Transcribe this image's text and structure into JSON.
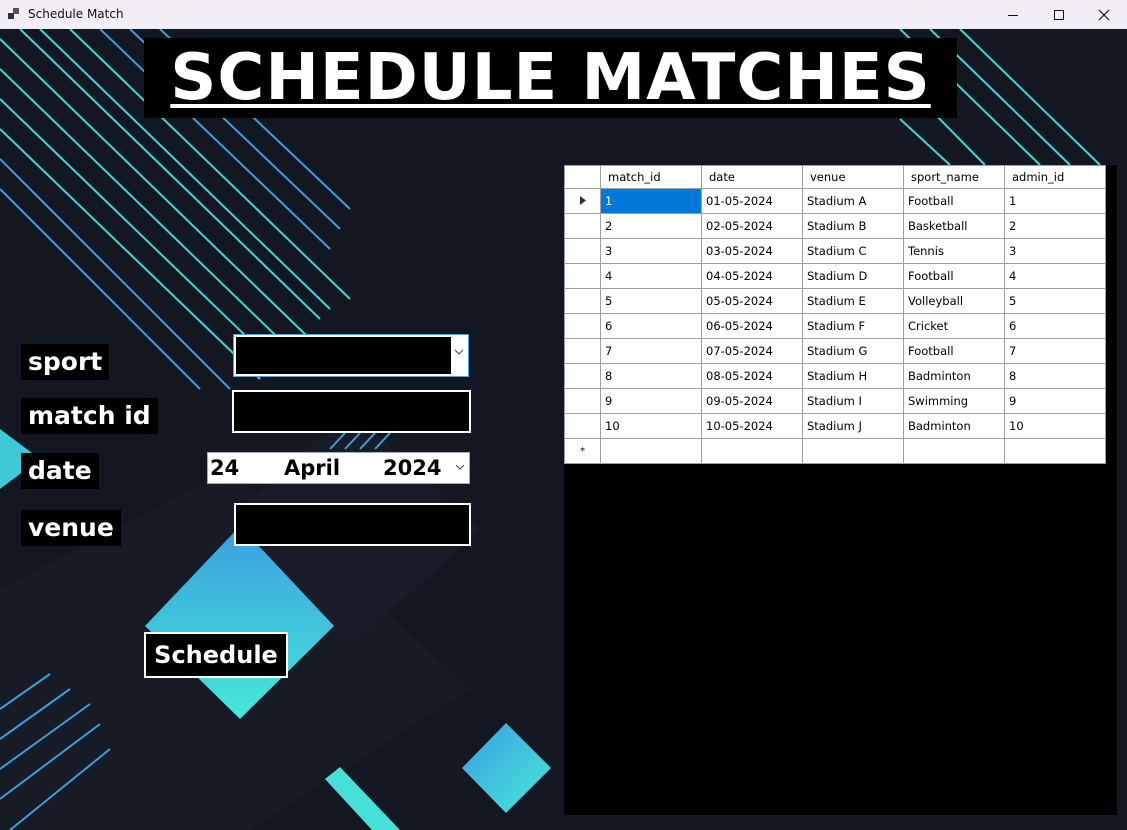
{
  "window": {
    "title": "Schedule Match",
    "icon": "app-window-icon",
    "controls": [
      "minimize-icon",
      "maximize-icon",
      "close-icon"
    ]
  },
  "heading": "SCHEDULE MATCHES",
  "form": {
    "sport_label": "sport",
    "match_id_label": "match id",
    "date_label": "date",
    "venue_label": "venue",
    "date": {
      "day": "24",
      "month": "April",
      "year": "2024"
    },
    "schedule_button": "Schedule"
  },
  "grid": {
    "columns": [
      "match_id",
      "date",
      "venue",
      "sport_name",
      "admin_id"
    ],
    "rows": [
      [
        "1",
        "01-05-2024",
        "Stadium A",
        "Football",
        "1"
      ],
      [
        "2",
        "02-05-2024",
        "Stadium B",
        "Basketball",
        "2"
      ],
      [
        "3",
        "03-05-2024",
        "Stadium C",
        "Tennis",
        "3"
      ],
      [
        "4",
        "04-05-2024",
        "Stadium D",
        "Football",
        "4"
      ],
      [
        "5",
        "05-05-2024",
        "Stadium E",
        "Volleyball",
        "5"
      ],
      [
        "6",
        "06-05-2024",
        "Stadium F",
        "Cricket",
        "6"
      ],
      [
        "7",
        "07-05-2024",
        "Stadium G",
        "Football",
        "7"
      ],
      [
        "8",
        "08-05-2024",
        "Stadium H",
        "Badminton",
        "8"
      ],
      [
        "9",
        "09-05-2024",
        "Stadium I",
        "Swimming",
        "9"
      ],
      [
        "10",
        "10-05-2024",
        "Stadium J",
        "Badminton",
        "10"
      ]
    ],
    "selected_row": 0,
    "new_row_marker": "*",
    "selection_color": "#0078d7"
  },
  "colors": {
    "background": "#131722",
    "accent_cyan": "#46e0d8",
    "accent_blue": "#3a9ee0"
  }
}
